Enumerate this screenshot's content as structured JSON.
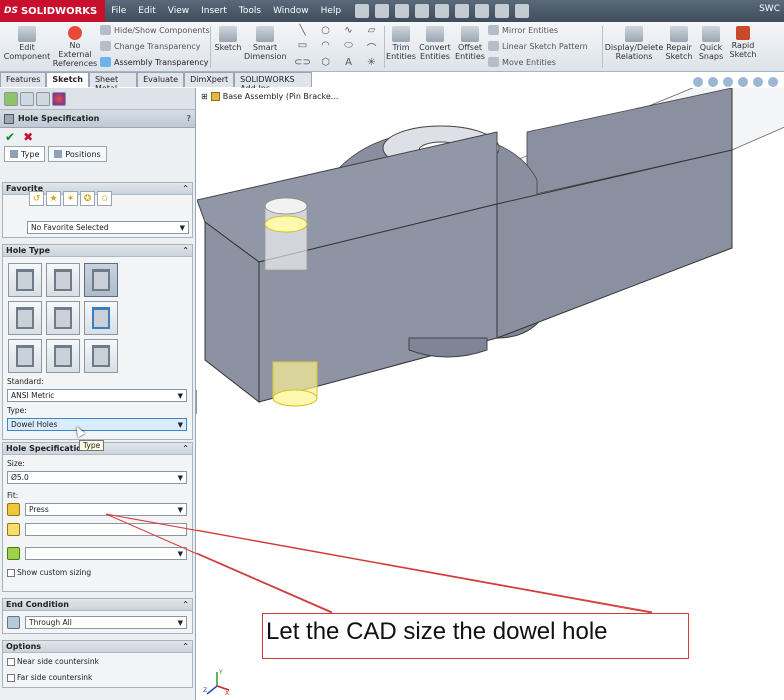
{
  "app": {
    "name": "SOLIDWORKS",
    "menu": [
      "File",
      "Edit",
      "View",
      "Insert",
      "Tools",
      "Window",
      "Help"
    ],
    "window_title_fragment": "SWC"
  },
  "ribbon": {
    "edit_component": "Edit Component",
    "no_external_refs": "No External References",
    "hide_show": "Hide/Show Components",
    "change_transparency": "Change Transparency",
    "assembly_transparency": "Assembly Transparency",
    "sketch": "Sketch",
    "smart_dimension": "Smart Dimension",
    "trim_entities": "Trim Entities",
    "convert_entities": "Convert Entities",
    "offset_entities": "Offset Entities",
    "mirror_entities": "Mirror Entities",
    "linear_sketch_pattern": "Linear Sketch Pattern",
    "move_entities": "Move Entities",
    "display_delete_relations": "Display/Delete Relations",
    "repair_sketch": "Repair Sketch",
    "quick_snaps": "Quick Snaps",
    "rapid_sketch": "Rapid Sketch"
  },
  "tabs": [
    "Features",
    "Sketch",
    "Sheet Metal",
    "Evaluate",
    "DimXpert",
    "SOLIDWORKS Add-Ins"
  ],
  "active_tab": "Sketch",
  "property_manager": {
    "title": "Hole Specification",
    "help": "?",
    "ok": "✔",
    "cancel": "✖",
    "subtab_type": "Type",
    "subtab_positions": "Positions",
    "favorite": {
      "header": "Favorite",
      "selected": "No Favorite Selected"
    },
    "hole_type": {
      "header": "Hole Type",
      "standard_label": "Standard:",
      "standard_value": "ANSI Metric",
      "type_label": "Type:",
      "type_value": "Dowel Holes",
      "tooltip": "Type"
    },
    "hole_specs": {
      "header": "Hole Specifications",
      "size_label": "Size:",
      "size_value": "Ø5.0",
      "fit_label": "Fit:",
      "fit_value": "Press",
      "show_custom_sizing": "Show custom sizing"
    },
    "end_condition": {
      "header": "End Condition",
      "value": "Through All"
    },
    "options": {
      "header": "Options",
      "near_side": "Near side countersink",
      "far_side": "Far side countersink"
    }
  },
  "viewport": {
    "tree_label": "Base Assembly  (Pin Bracke...",
    "callout": "Let the CAD size the dowel hole",
    "callout_color": "#d23a3a",
    "triad": {
      "x": "X",
      "y": "Y",
      "z": "Z"
    }
  }
}
